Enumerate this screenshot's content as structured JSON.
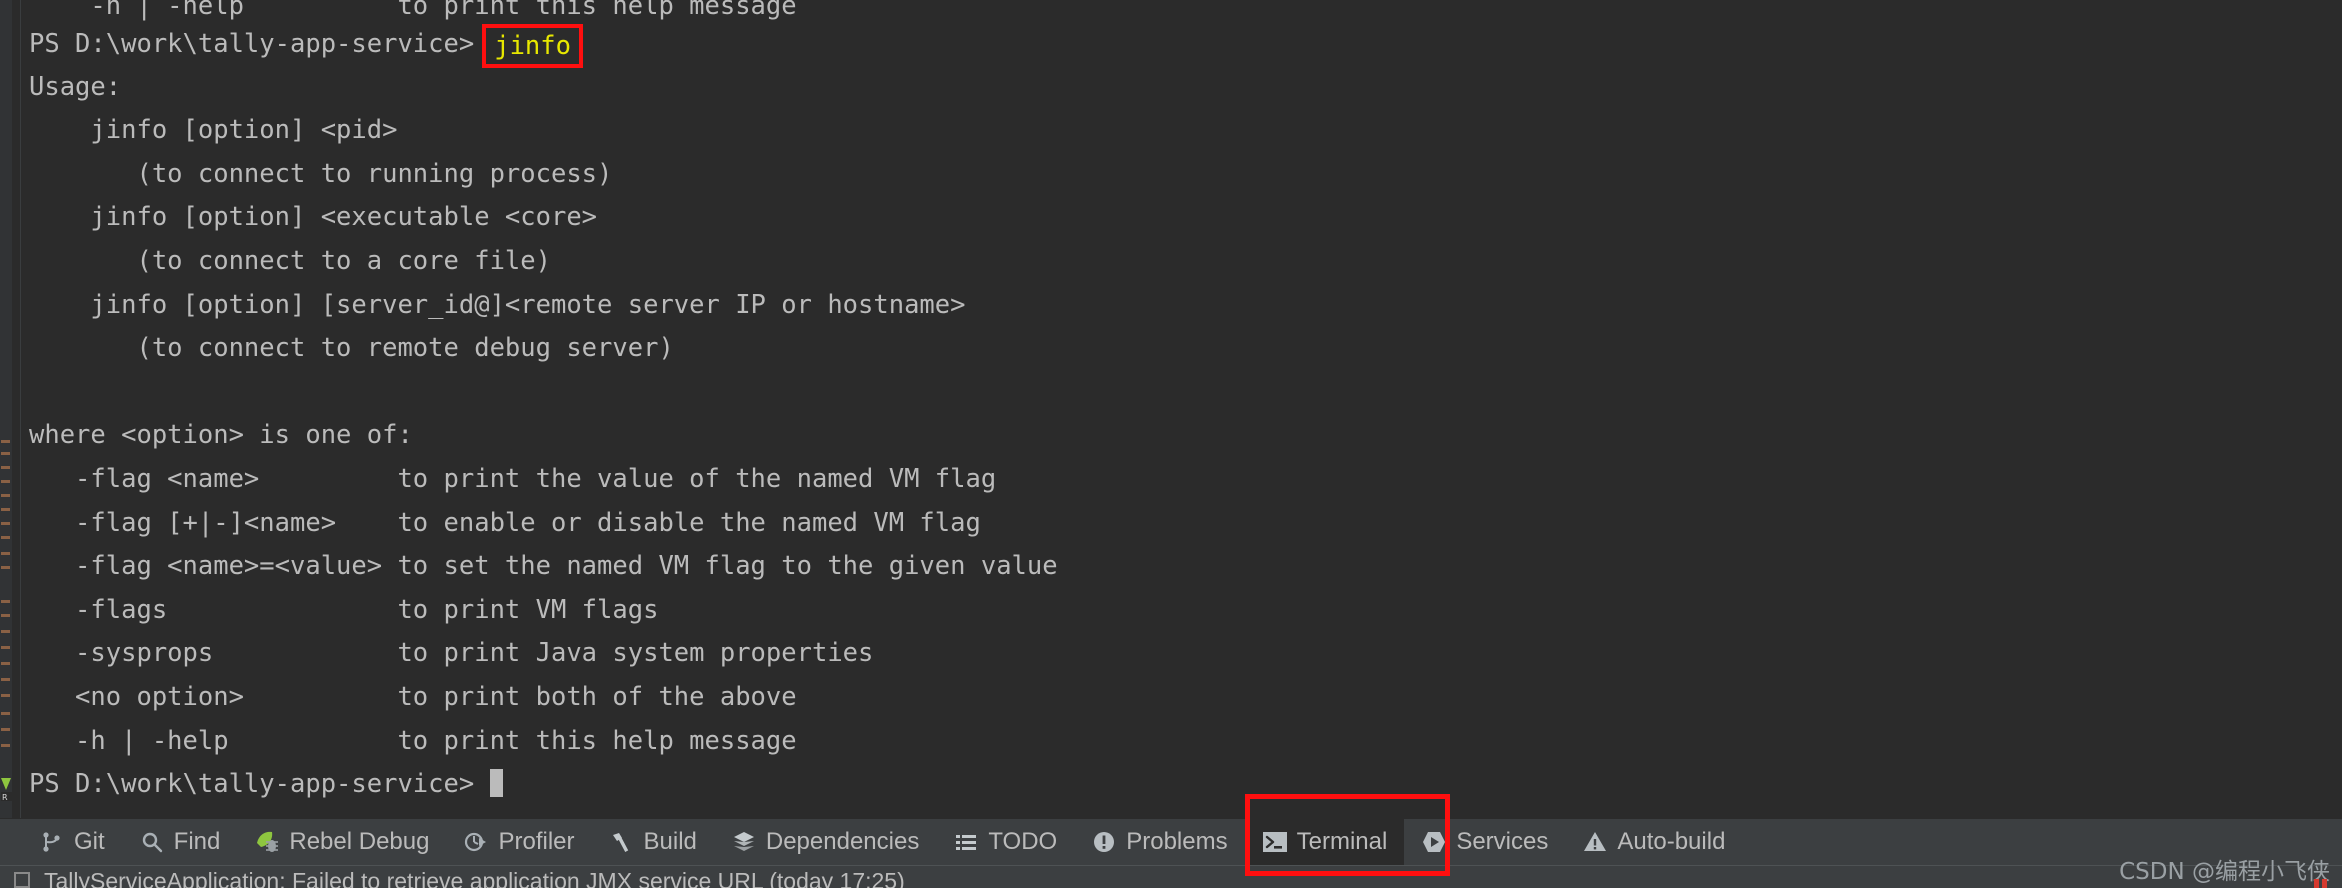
{
  "terminal": {
    "cut_off_top_line": "    -h | -help          to print this help message",
    "prompt": "PS D:\\work\\tally-app-service>",
    "command": "jinfo",
    "output_lines": [
      "Usage:",
      "    jinfo [option] <pid>",
      "       (to connect to running process)",
      "    jinfo [option] <executable <core>",
      "       (to connect to a core file)",
      "    jinfo [option] [server_id@]<remote server IP or hostname>",
      "       (to connect to remote debug server)",
      "",
      "where <option> is one of:",
      "   -flag <name>         to print the value of the named VM flag",
      "   -flag [+|-]<name>    to enable or disable the named VM flag",
      "   -flag <name>=<value> to set the named VM flag to the given value",
      "   -flags               to print VM flags",
      "   -sysprops            to print Java system properties",
      "   <no option>          to print both of the above",
      "   -h | -help           to print this help message"
    ],
    "final_prompt": "PS D:\\work\\tally-app-service>",
    "colors": {
      "background": "#2b2b2b",
      "text": "#bbbbbb",
      "command": "#e8e800",
      "annotation": "#ff0f0f"
    }
  },
  "toolbar": {
    "items": [
      {
        "label": "Git",
        "icon": "git-branch-icon",
        "active": false
      },
      {
        "label": "Find",
        "icon": "search-icon",
        "active": false
      },
      {
        "label": "Rebel Debug",
        "icon": "rocket-bug-icon",
        "active": false
      },
      {
        "label": "Profiler",
        "icon": "profiler-icon",
        "active": false
      },
      {
        "label": "Build",
        "icon": "hammer-icon",
        "active": false
      },
      {
        "label": "Dependencies",
        "icon": "layers-icon",
        "active": false
      },
      {
        "label": "TODO",
        "icon": "list-icon",
        "active": false
      },
      {
        "label": "Problems",
        "icon": "exclamation-circle-icon",
        "active": false
      },
      {
        "label": "Terminal",
        "icon": "terminal-icon",
        "active": true
      },
      {
        "label": "Services",
        "icon": "play-hexagon-icon",
        "active": false
      },
      {
        "label": "Auto-build",
        "icon": "warning-triangle-icon",
        "active": false
      }
    ]
  },
  "statusbar": {
    "message": "TallyServiceApplication: Failed to retrieve application JMX service URL (today 17:25)"
  },
  "watermark": {
    "text": "CSDN @编程小飞侠"
  }
}
